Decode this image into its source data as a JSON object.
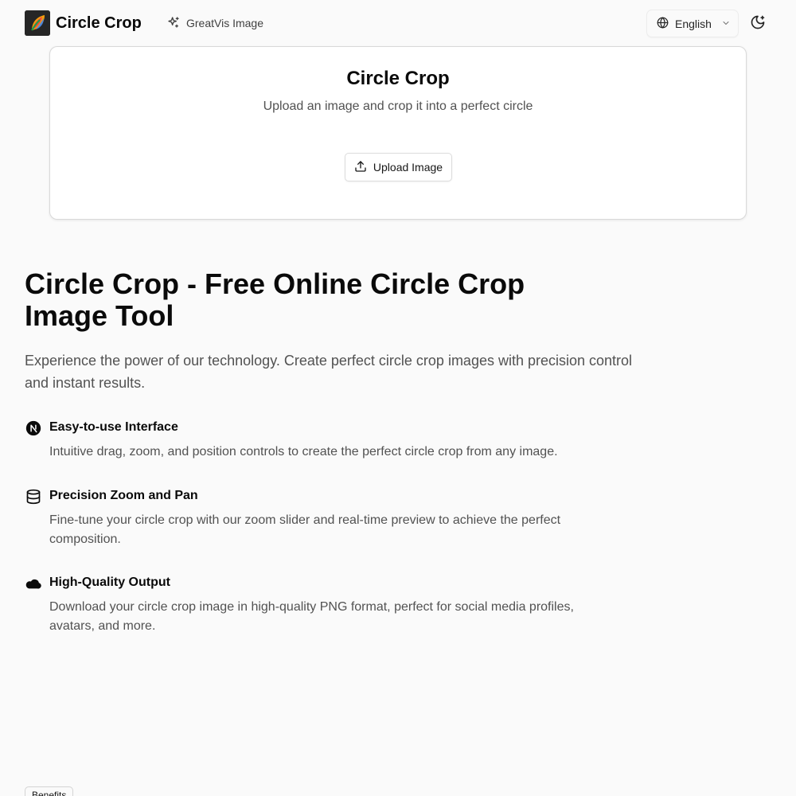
{
  "header": {
    "brand": "Circle Crop",
    "nav_link": "GreatVis Image",
    "language": "English"
  },
  "tool_card": {
    "title": "Circle Crop",
    "subtitle": "Upload an image and crop it into a perfect circle",
    "upload_label": "Upload Image"
  },
  "hero": {
    "title_line1": "Circle Crop - Free Online Circle Crop",
    "title_line2": "Image Tool",
    "description": "Experience the power of our technology. Create perfect circle crop images with precision control and instant results."
  },
  "features": [
    {
      "icon": "nextjs-icon",
      "title": "Easy-to-use Interface",
      "description": "Intuitive drag, zoom, and position controls to create the perfect circle crop from any image."
    },
    {
      "icon": "database-icon",
      "title": "Precision Zoom and Pan",
      "description": "Fine-tune your circle crop with our zoom slider and real-time preview to achieve the perfect composition."
    },
    {
      "icon": "cloud-icon",
      "title": "High-Quality Output",
      "description": "Download your circle crop image in high-quality PNG format, perfect for social media profiles, avatars, and more."
    }
  ],
  "benefits_badge": "Benefits",
  "colors": {
    "background": "#fafafa",
    "text": "#0a0a0a",
    "muted": "#525252"
  }
}
